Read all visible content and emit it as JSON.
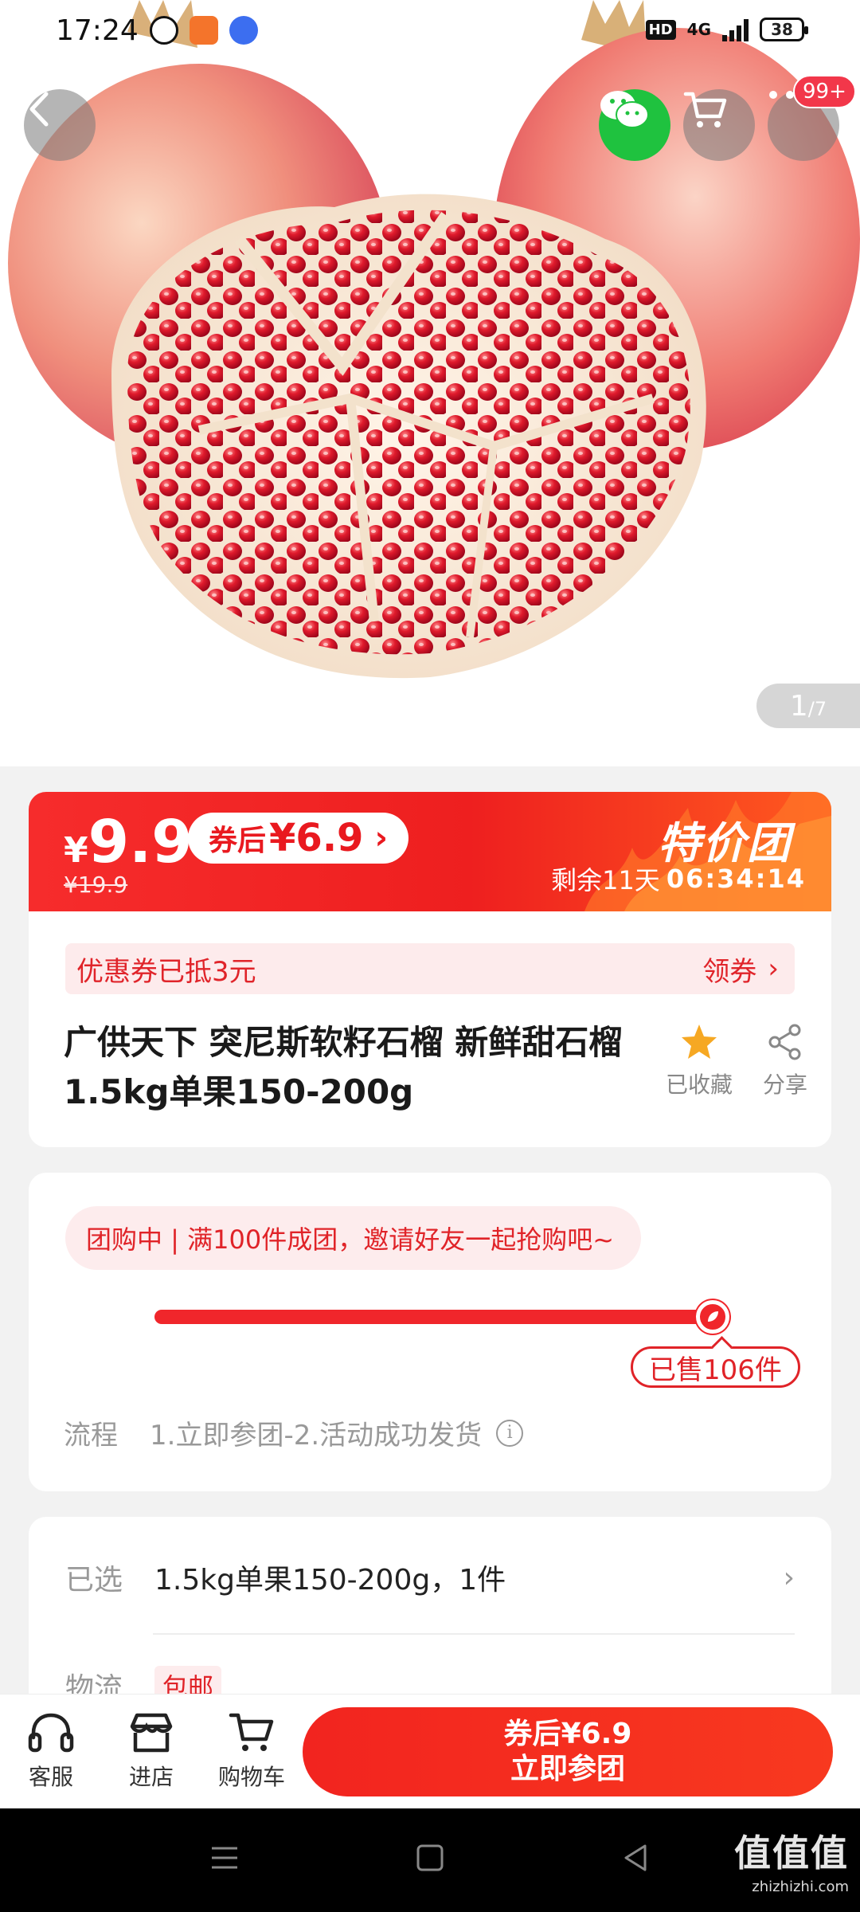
{
  "status_bar": {
    "time": "17:24",
    "hd": "HD",
    "network": "4G",
    "battery": "38"
  },
  "top_nav": {
    "cart_badge": "99+"
  },
  "gallery": {
    "current": "1",
    "total": "/7"
  },
  "price": {
    "currency": "¥",
    "current": "9.9",
    "original": "¥19.9",
    "coupon_label": "券后",
    "coupon_price": "¥6.9",
    "coupon_arrow": "›",
    "promo_label": "特价团",
    "remaining_label": "剩余11天",
    "countdown": "06:34:14"
  },
  "coupon_bar": {
    "text": "优惠券已抵3元",
    "action": "领券",
    "arrow": "›"
  },
  "product": {
    "title": "广供天下 突尼斯软籽石榴 新鲜甜石榴 1.5kg单果150-200g",
    "fav_label": "已收藏",
    "share_label": "分享"
  },
  "group_buy": {
    "status_text": "团购中 | 满100件成团，邀请好友一起抢购吧~",
    "sold_text": "已售106件",
    "progress": 1.0,
    "flow_label": "流程",
    "flow_text": "1.立即参团-2.活动成功发货",
    "info_icon": "i"
  },
  "spec": {
    "selected_label": "已选",
    "selected_value": "1.5kg单果150-200g，1件",
    "chevron": "›",
    "shipping_label": "物流",
    "shipping_tag": "包邮"
  },
  "bottom_bar": {
    "service": "客服",
    "store": "进店",
    "cart": "购物车",
    "buy_line1": "券后¥6.9",
    "buy_line2": "立即参团"
  },
  "watermark": {
    "big": "值值值",
    "small": "zhizhizhi.com"
  },
  "colors": {
    "accent": "#f0262b",
    "wechat": "#1fc23f",
    "coupon_bg": "#fdebec"
  },
  "icons": [
    "back-icon",
    "wechat-icon",
    "cart-icon",
    "more-icon",
    "star-icon",
    "share-icon",
    "headset-icon",
    "store-icon",
    "info-icon"
  ]
}
